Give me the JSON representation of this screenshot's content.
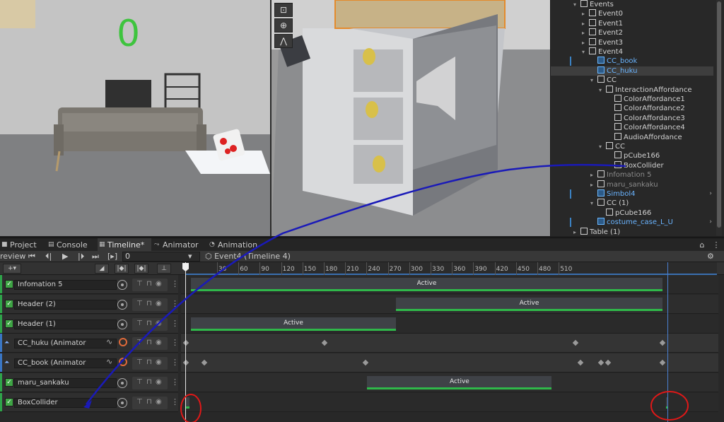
{
  "game_view": {
    "counter": "0"
  },
  "hierarchy": {
    "rows": [
      {
        "label": "Events",
        "depth": 0,
        "arrow": "▾"
      },
      {
        "label": "Event0",
        "depth": 1,
        "arrow": "▸"
      },
      {
        "label": "Event1",
        "depth": 1,
        "arrow": "▸"
      },
      {
        "label": "Event2",
        "depth": 1,
        "arrow": "▸"
      },
      {
        "label": "Event3",
        "depth": 1,
        "arrow": "▸"
      },
      {
        "label": "Event4",
        "depth": 1,
        "arrow": "▾"
      },
      {
        "label": "CC_book",
        "depth": 2,
        "arrow": "",
        "style": "prefab"
      },
      {
        "label": "CC_huku",
        "depth": 2,
        "arrow": "",
        "style": "prefab-selected"
      },
      {
        "label": "CC",
        "depth": 2,
        "arrow": "▾"
      },
      {
        "label": "InteractionAffordance",
        "depth": 3,
        "arrow": "▾"
      },
      {
        "label": "ColorAffordance1",
        "depth": 4,
        "arrow": ""
      },
      {
        "label": "ColorAffordance2",
        "depth": 4,
        "arrow": ""
      },
      {
        "label": "ColorAffordance3",
        "depth": 4,
        "arrow": ""
      },
      {
        "label": "ColorAffordance4",
        "depth": 4,
        "arrow": ""
      },
      {
        "label": "AudioAffordance",
        "depth": 4,
        "arrow": ""
      },
      {
        "label": "CC",
        "depth": 3,
        "arrow": "▾"
      },
      {
        "label": "pCube166",
        "depth": 4,
        "arrow": ""
      },
      {
        "label": "BoxCollider",
        "depth": 4,
        "arrow": ""
      },
      {
        "label": "Infomation 5",
        "depth": 2,
        "arrow": "▸",
        "style": "dim"
      },
      {
        "label": "maru_sankaku",
        "depth": 2,
        "arrow": "▸",
        "style": "dim"
      },
      {
        "label": "Simbol4",
        "depth": 2,
        "arrow": "",
        "style": "prefab",
        "chevron": "›"
      },
      {
        "label": "CC (1)",
        "depth": 2,
        "arrow": "▾"
      },
      {
        "label": "pCube166",
        "depth": 3,
        "arrow": ""
      },
      {
        "label": "costume_case_L_U",
        "depth": 2,
        "arrow": "",
        "style": "prefab",
        "chevron": "›"
      },
      {
        "label": "Table (1)",
        "depth": 0,
        "arrow": "▸"
      }
    ]
  },
  "tabs": [
    {
      "label": "Project",
      "icon": "folder-icon"
    },
    {
      "label": "Console",
      "icon": "console-icon"
    },
    {
      "label": "Timeline*",
      "icon": "timeline-icon",
      "active": true
    },
    {
      "label": "Animator",
      "icon": "animator-icon"
    },
    {
      "label": "Animation",
      "icon": "animation-icon"
    }
  ],
  "toolbar": {
    "preview_label": "review",
    "frame_value": "0",
    "breadcrumb": "Event4 (Timeline 4)"
  },
  "ruler": {
    "ticks": [
      "30",
      "60",
      "90",
      "120",
      "150",
      "180",
      "210",
      "240",
      "270",
      "300",
      "330",
      "360",
      "390",
      "420",
      "450",
      "480",
      "510"
    ]
  },
  "tracks": [
    {
      "name": "Infomation 5",
      "type": "activation",
      "clips": [
        {
          "label": "Active",
          "start": 0,
          "end": 460
        }
      ]
    },
    {
      "name": "Header (2)",
      "type": "activation",
      "clips": [
        {
          "label": "Active",
          "start": 200,
          "end": 460
        }
      ]
    },
    {
      "name": "Header (1)",
      "type": "activation",
      "clips": [
        {
          "label": "Active",
          "start": 0,
          "end": 200
        }
      ]
    },
    {
      "name": "CC_huku (Animator",
      "type": "animation",
      "keys": [
        0,
        135,
        380,
        465
      ]
    },
    {
      "name": "CC_book (Animator",
      "type": "animation",
      "keys": [
        0,
        18,
        175,
        385,
        405,
        412,
        465
      ]
    },
    {
      "name": "maru_sankaku",
      "type": "activation",
      "clips": [
        {
          "label": "Active",
          "start": 172,
          "end": 352
        }
      ]
    },
    {
      "name": "BoxCollider",
      "type": "activation",
      "clips": []
    }
  ],
  "colors": {
    "accent_green": "#2fb84a",
    "playhead_end": "#4a7fd0",
    "annotation_blue": "#1a1ab8",
    "annotation_red": "#e01818"
  }
}
